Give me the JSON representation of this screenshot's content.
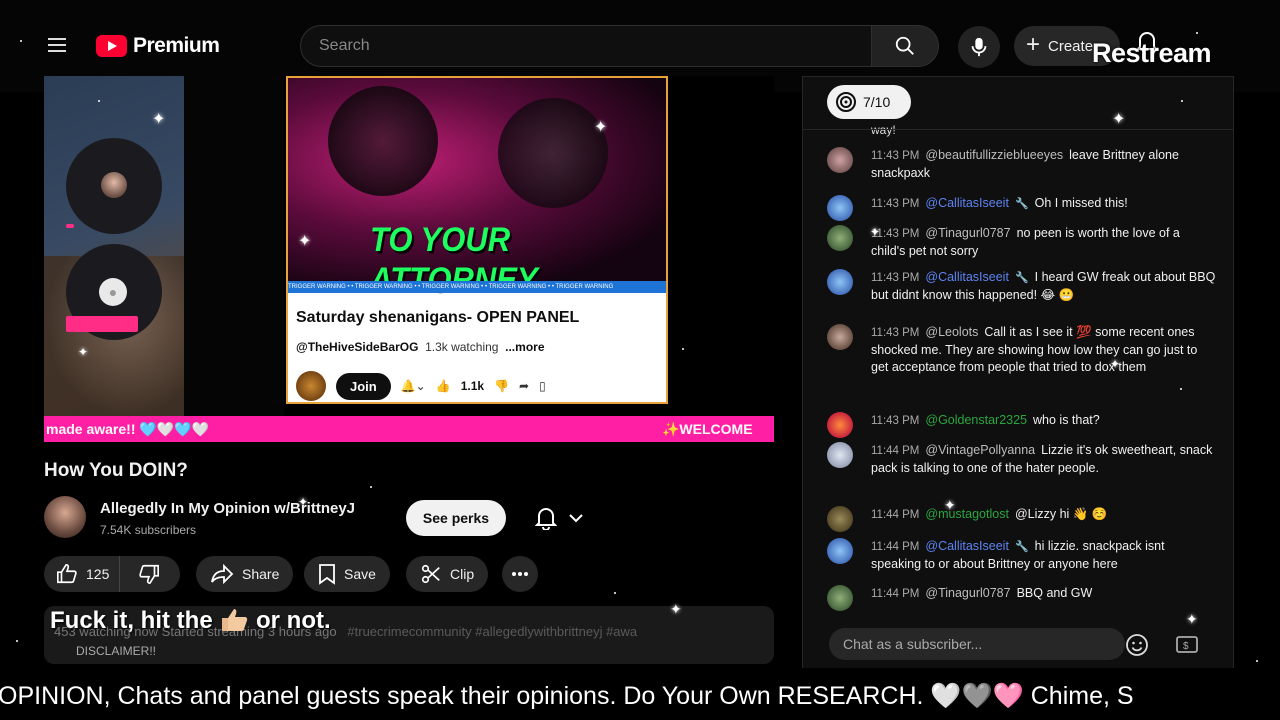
{
  "header": {
    "logo_text": "Premium",
    "search_placeholder": "Search",
    "create_label": "Create",
    "overlay_brand": "Restream"
  },
  "stream": {
    "inner_headline": "TO YOUR ATTORNEY",
    "inner_title": "Saturday shenanigans- OPEN PANEL",
    "inner_channel": "@TheHiveSideBarOG",
    "inner_watching": "1.3k watching",
    "inner_more": "...more",
    "inner_join": "Join",
    "inner_likes": "1.1k",
    "inner_warning": "TRIGGER WARNING • • TRIGGER WARNING • • TRIGGER WARNING • • TRIGGER WARNING • • TRIGGER WARNING",
    "pink_bar_left": "made aware!! 🩵🤍🩵🤍",
    "pink_bar_right": "✨WELCOME"
  },
  "video": {
    "title": "How You DOIN?",
    "channel_name": "Allegedly In My Opinion w/BrittneyJ",
    "subscribers": "7.54K subscribers",
    "perks_label": "See perks",
    "like_count": "125",
    "share_label": "Share",
    "save_label": "Save",
    "clip_label": "Clip",
    "desc_line": "453 watching now  Started streaming 3 hours ago",
    "desc_tags": "#truecrimecommunity #allegedlywithbrittneyj #awa",
    "desc_disclaimer": "DISCLAIMER!!",
    "overlay_caption_a": "Fuck it, hit the",
    "overlay_caption_b": "or not."
  },
  "chat": {
    "counter": "7/10",
    "cut_text": "way!",
    "input_placeholder": "Chat as a subscriber...",
    "messages": [
      {
        "time": "11:43 PM",
        "user": "@beautifullizzieblueeyes",
        "text": "leave Brittney alone snackpaxk"
      },
      {
        "time": "11:43 PM",
        "user": "@CallitasIseeit",
        "text": "Oh I missed this!"
      },
      {
        "time": "11:43 PM",
        "user": "@Tinagurl0787",
        "text": "no peen is worth the love of a child's pet not sorry"
      },
      {
        "time": "11:43 PM",
        "user": "@CallitasIseeit",
        "text": "I heard GW freak out about BBQ but didnt know this happened! 😂 😬"
      },
      {
        "time": "11:43 PM",
        "user": "@Leolots",
        "text": "Call it as I see it 💯 some recent ones shocked me. They are showing how low they can go just to get acceptance from people that tried to dox them"
      },
      {
        "time": "11:43 PM",
        "user": "@Goldenstar2325",
        "text": "who is that?"
      },
      {
        "time": "11:44 PM",
        "user": "@VintagePollyanna",
        "text": "Lizzie it's ok sweetheart, snack pack is talking to one of the hater people."
      },
      {
        "time": "11:44 PM",
        "user": "@mustagotlost",
        "text": "@Lizzy hi 👋 ☺️"
      },
      {
        "time": "11:44 PM",
        "user": "@CallitasIseeit",
        "text": "hi lizzie. snackpack isnt speaking to or about Brittney or anyone here"
      },
      {
        "time": "11:44 PM",
        "user": "@Tinagurl0787",
        "text": "BBQ and GW"
      }
    ]
  },
  "ticker": {
    "text": "OPINION, Chats and panel guests speak their opinions. Do Your Own RESEARCH. 🤍🩶🩷      Chime, S"
  },
  "colors": {
    "brand_red": "#ff0033",
    "pink_bar": "#ff1fa5",
    "attorney_green": "#1cff5e",
    "chat_blue": "#5e84f1",
    "chat_green": "#2ba640"
  }
}
